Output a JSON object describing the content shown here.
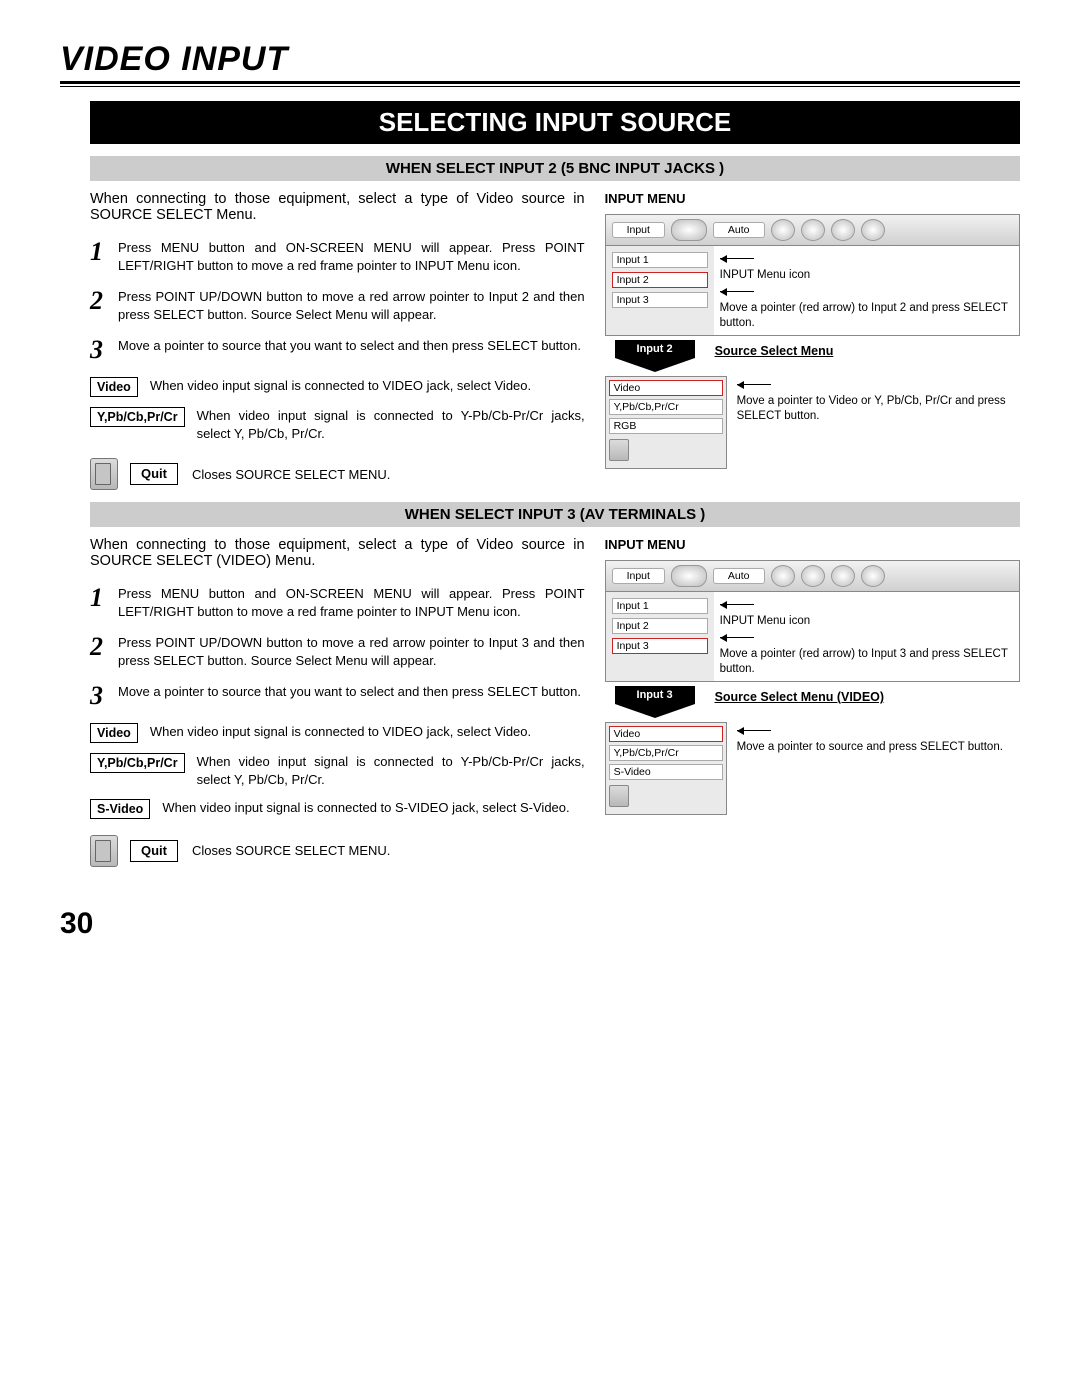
{
  "page": {
    "title": "VIDEO INPUT",
    "banner": "SELECTING INPUT SOURCE",
    "pageNumber": "30"
  },
  "sec2": {
    "header": "WHEN SELECT INPUT 2 (5 BNC INPUT JACKS )",
    "intro": "When connecting to those equipment, select a type of Video source in SOURCE SELECT Menu.",
    "steps": {
      "s1": "Press MENU button and ON-SCREEN MENU will appear. Press POINT LEFT/RIGHT button to move a red frame pointer to INPUT Menu icon.",
      "s2": "Press POINT UP/DOWN button to move a red arrow pointer to Input 2 and then press SELECT button. Source Select Menu will appear.",
      "s3": "Move a pointer to source that you want to select and then press SELECT button."
    },
    "terms": {
      "video": {
        "label": "Video",
        "text": "When video input signal is connected to VIDEO jack, select Video."
      },
      "ypbcb": {
        "label": "Y,Pb/Cb,Pr/Cr",
        "text": "When video input signal is connected to Y-Pb/Cb-Pr/Cr jacks, select Y, Pb/Cb, Pr/Cr."
      }
    },
    "quit": {
      "label": "Quit",
      "text": "Closes SOURCE SELECT MENU."
    },
    "right": {
      "title": "INPUT MENU",
      "menuTab": "Input",
      "autoTab": "Auto",
      "items": {
        "i1": "Input 1",
        "i2": "Input 2",
        "i3": "Input 3"
      },
      "note1": "INPUT Menu icon",
      "note2": "Move a pointer (red arrow) to Input 2 and press SELECT button.",
      "arrowLabel": "Input 2",
      "srcTitle": "Source Select Menu",
      "srcItems": {
        "v": "Video",
        "y": "Y,Pb/Cb,Pr/Cr",
        "r": "RGB"
      },
      "srcNote": "Move a pointer to Video or Y, Pb/Cb, Pr/Cr and press SELECT button."
    }
  },
  "sec3": {
    "header": "WHEN SELECT INPUT 3 (AV TERMINALS )",
    "intro": "When connecting to those equipment, select a type of Video source in SOURCE SELECT (VIDEO) Menu.",
    "steps": {
      "s1": "Press MENU button and ON-SCREEN MENU will appear. Press POINT LEFT/RIGHT button to move a red frame pointer to INPUT Menu icon.",
      "s2": "Press POINT UP/DOWN button to move a red arrow pointer to Input 3 and then press SELECT button. Source Select Menu will appear.",
      "s3": "Move a pointer to source that you want to select and then press SELECT button."
    },
    "terms": {
      "video": {
        "label": "Video",
        "text": "When video input signal is connected to VIDEO jack, select Video."
      },
      "ypbcb": {
        "label": "Y,Pb/Cb,Pr/Cr",
        "text": "When video input signal is connected to Y-Pb/Cb-Pr/Cr jacks, select Y, Pb/Cb, Pr/Cr."
      },
      "svideo": {
        "label": "S-Video",
        "text": "When video input signal is connected to S-VIDEO jack, select S-Video."
      }
    },
    "quit": {
      "label": "Quit",
      "text": "Closes SOURCE SELECT MENU."
    },
    "right": {
      "title": "INPUT MENU",
      "menuTab": "Input",
      "autoTab": "Auto",
      "items": {
        "i1": "Input 1",
        "i2": "Input 2",
        "i3": "Input 3"
      },
      "note1": "INPUT Menu icon",
      "note2": "Move a pointer (red arrow) to Input 3 and press SELECT button.",
      "arrowLabel": "Input 3",
      "srcTitle": "Source Select Menu (VIDEO)",
      "srcItems": {
        "v": "Video",
        "y": "Y,Pb/Cb,Pr/Cr",
        "s": "S-Video"
      },
      "srcNote": "Move a pointer to source and press SELECT button."
    }
  }
}
